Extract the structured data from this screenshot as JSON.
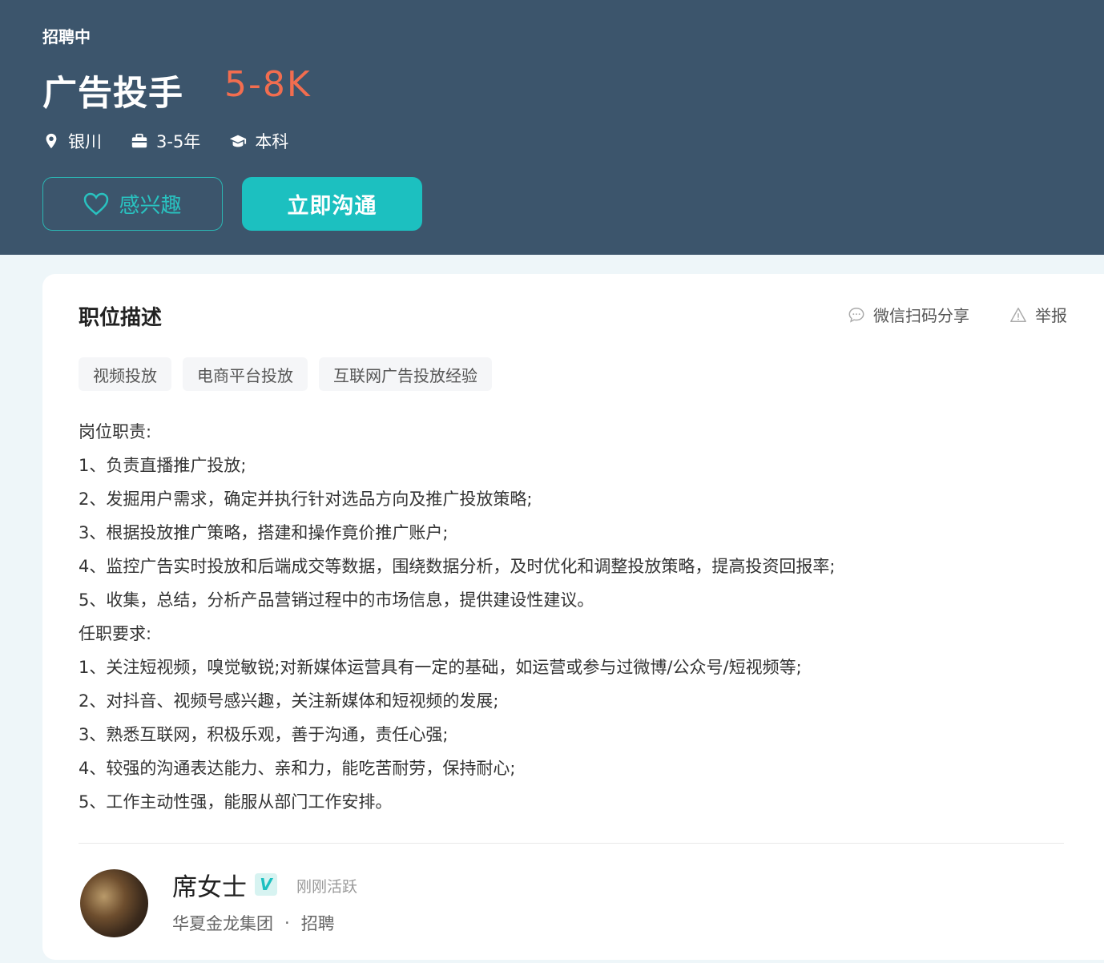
{
  "header": {
    "status": "招聘中",
    "title": "广告投手",
    "salary": "5-8K",
    "meta": {
      "location": "银川",
      "experience": "3-5年",
      "education": "本科"
    },
    "interest_button": "感兴趣",
    "chat_button": "立即沟通"
  },
  "colors": {
    "banner": "#3c556c",
    "salary": "#f26d4f",
    "accent": "#1cc0c0"
  },
  "description": {
    "title": "职位描述",
    "share_label": "微信扫码分享",
    "report_label": "举报",
    "tags": [
      "视频投放",
      "电商平台投放",
      "互联网广告投放经验"
    ],
    "lines": [
      "岗位职责:",
      "1、负责直播推广投放;",
      "2、发掘用户需求，确定并执行针对选品方向及推广投放策略;",
      "3、根据投放推广策略，搭建和操作竟价推广账户;",
      "4、监控广告实时投放和后端成交等数据，围绕数据分析，及时优化和调整投放策略，提高投资回报率;",
      "5、收集，总结，分析产品营销过程中的市场信息，提供建设性建议。",
      "任职要求:",
      "1、关注短视频，嗅觉敏锐;对新媒体运营具有一定的基础，如运营或参与过微博/公众号/短视频等;",
      "2、对抖音、视频号感兴趣，关注新媒体和短视频的发展;",
      "3、熟悉互联网，积极乐观，善于沟通，责任心强;",
      "4、较强的沟通表达能力、亲和力，能吃苦耐劳，保持耐心;",
      "5、工作主动性强，能服从部门工作安排。"
    ]
  },
  "recruiter": {
    "name": "席女士",
    "verified_badge": "V",
    "active_status": "刚刚活跃",
    "company": "华夏金龙集团",
    "separator": "·",
    "role": "招聘"
  }
}
